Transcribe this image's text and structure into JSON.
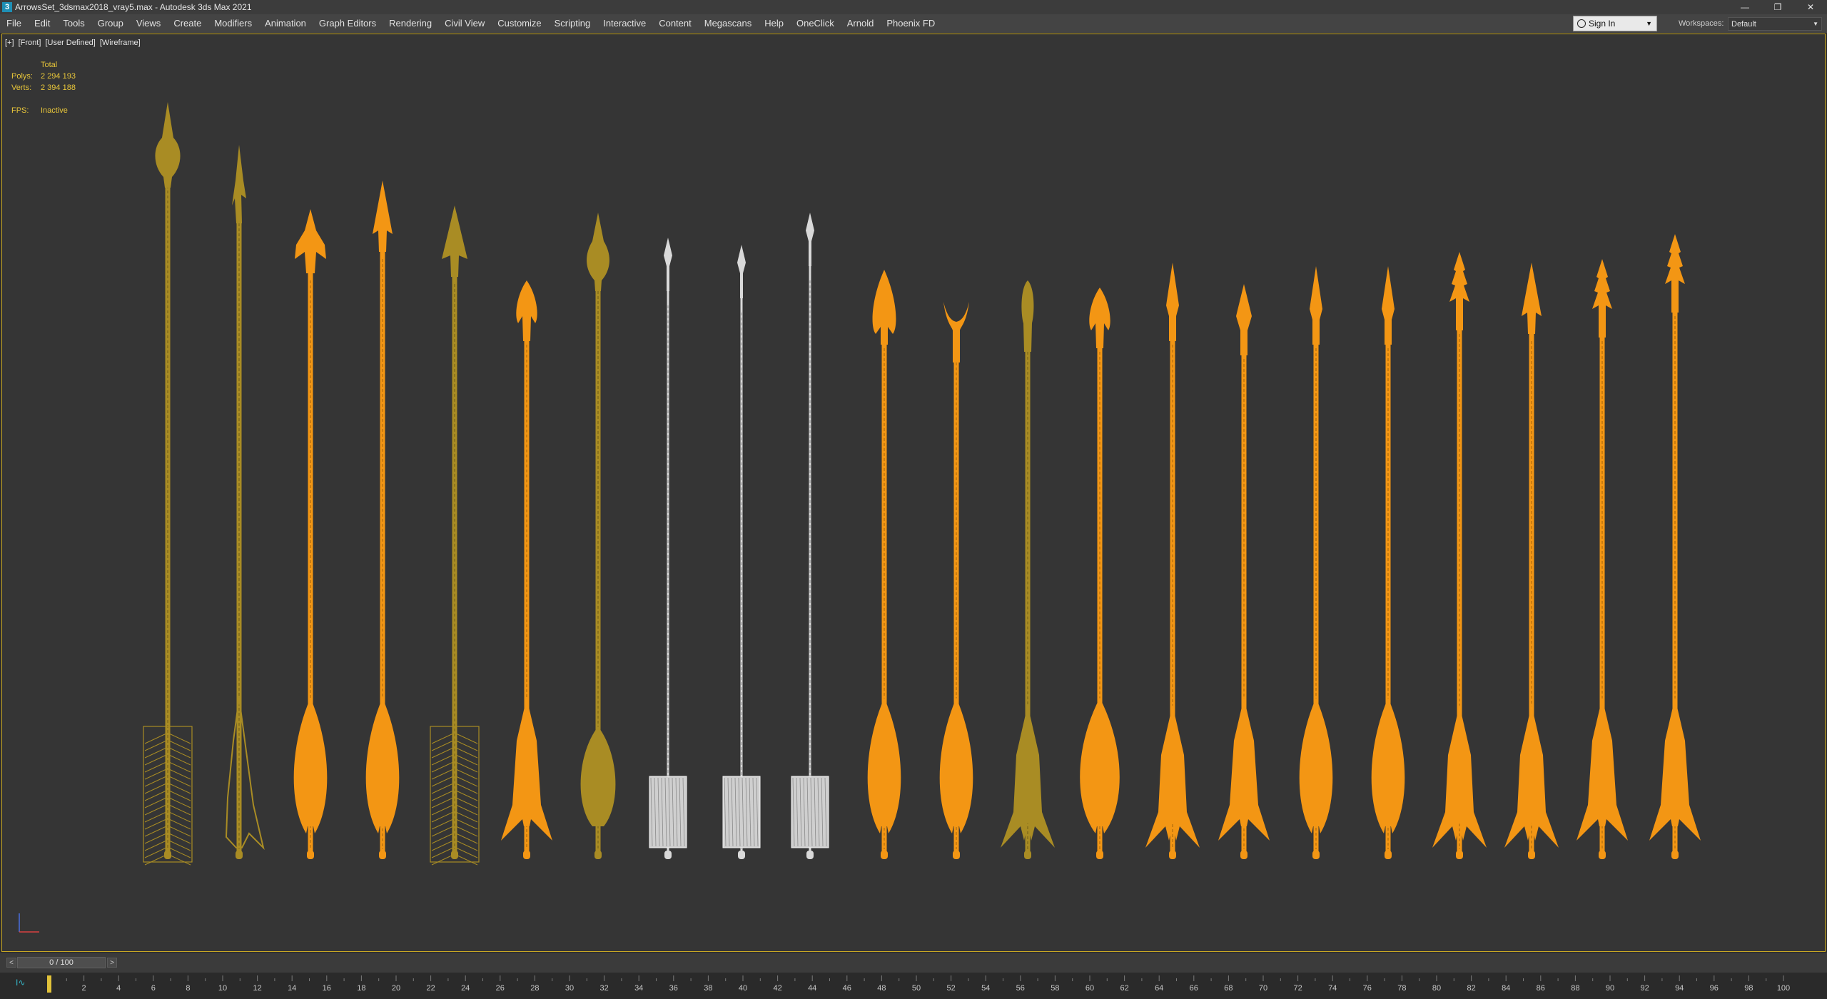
{
  "window": {
    "title": "ArrowsSet_3dsmax2018_vray5.max - Autodesk 3ds Max 2021",
    "app_icon": "3",
    "controls": [
      "—",
      "❐",
      "✕"
    ]
  },
  "menu": {
    "items": [
      "File",
      "Edit",
      "Tools",
      "Group",
      "Views",
      "Create",
      "Modifiers",
      "Animation",
      "Graph Editors",
      "Rendering",
      "Civil View",
      "Customize",
      "Scripting",
      "Interactive",
      "Content",
      "Megascans",
      "Help",
      "OneClick",
      "Arnold",
      "Phoenix FD"
    ],
    "sign_in": "Sign In",
    "workspaces_label": "Workspaces:",
    "workspace_value": "Default"
  },
  "viewport": {
    "labels": [
      "[+]",
      "[Front]",
      "[User Defined]",
      "[Wireframe]"
    ],
    "stats": {
      "total_label": "Total",
      "polys_label": "Polys:",
      "polys_value": "2 294 193",
      "verts_label": "Verts:",
      "verts_value": "2 394 188",
      "fps_label": "FPS:",
      "fps_value": "Inactive"
    },
    "colors": {
      "olive": "#a98c24",
      "orange": "#f39614",
      "white": "#d9d9d9",
      "border": "#c9a824",
      "stats": "#e7c53a"
    },
    "arrows": [
      {
        "color": "olive",
        "head": "ornate-tall",
        "fletch": "hatched"
      },
      {
        "color": "olive",
        "head": "barbed-thin",
        "fletch": "ragged"
      },
      {
        "color": "orange",
        "head": "trident",
        "fletch": "leaf"
      },
      {
        "color": "orange",
        "head": "spear",
        "fletch": "leaf"
      },
      {
        "color": "olive",
        "head": "spear-wide",
        "fletch": "hatched"
      },
      {
        "color": "orange",
        "head": "flame",
        "fletch": "split"
      },
      {
        "color": "olive",
        "head": "ornate",
        "fletch": "bulb"
      },
      {
        "color": "white",
        "head": "small-diamond",
        "fletch": "block"
      },
      {
        "color": "white",
        "head": "small-diamond",
        "fletch": "block"
      },
      {
        "color": "white",
        "head": "small-diamond",
        "fletch": "block"
      },
      {
        "color": "orange",
        "head": "broad-leaf",
        "fletch": "leaf"
      },
      {
        "color": "orange",
        "head": "crescent",
        "fletch": "leaf"
      },
      {
        "color": "olive",
        "head": "bullet",
        "fletch": "fan"
      },
      {
        "color": "orange",
        "head": "flame",
        "fletch": "leaf-wide"
      },
      {
        "color": "orange",
        "head": "narrow",
        "fletch": "fan"
      },
      {
        "color": "orange",
        "head": "diamond",
        "fletch": "split"
      },
      {
        "color": "orange",
        "head": "narrow",
        "fletch": "leaf"
      },
      {
        "color": "orange",
        "head": "narrow",
        "fletch": "leaf"
      },
      {
        "color": "orange",
        "head": "serrated",
        "fletch": "fan"
      },
      {
        "color": "orange",
        "head": "spear",
        "fletch": "fan"
      },
      {
        "color": "orange",
        "head": "serrated",
        "fletch": "split"
      },
      {
        "color": "orange",
        "head": "serrated",
        "fletch": "split"
      }
    ]
  },
  "timeline": {
    "frame_indicator": "0 / 100",
    "prev": "<",
    "next": ">",
    "ruler_labels": [
      "2",
      "4",
      "6",
      "8",
      "10",
      "12",
      "14",
      "16",
      "18",
      "20",
      "22",
      "24",
      "26",
      "28",
      "30",
      "32",
      "34",
      "36",
      "38",
      "40",
      "42",
      "44",
      "46",
      "48",
      "50",
      "52",
      "54",
      "56",
      "58",
      "60",
      "62",
      "64",
      "66",
      "68",
      "70",
      "72",
      "74",
      "76",
      "78",
      "80",
      "82",
      "84",
      "86",
      "88",
      "90",
      "92",
      "94",
      "96",
      "98",
      "100"
    ]
  }
}
